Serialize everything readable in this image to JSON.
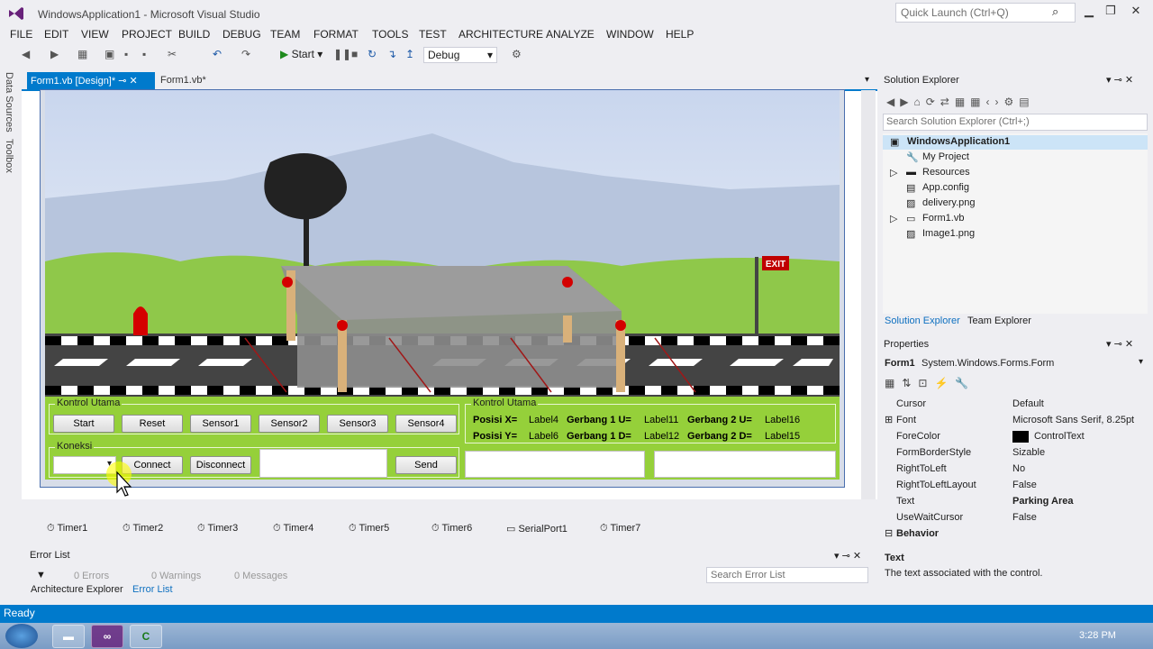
{
  "window": {
    "title": "WindowsApplication1 - Microsoft Visual Studio",
    "quick_launch_placeholder": "Quick Launch (Ctrl+Q)"
  },
  "menu": [
    "FILE",
    "EDIT",
    "VIEW",
    "PROJECT",
    "BUILD",
    "DEBUG",
    "TEAM",
    "FORMAT",
    "TOOLS",
    "TEST",
    "ARCHITECTURE",
    "ANALYZE",
    "WINDOW",
    "HELP"
  ],
  "toolbar": {
    "start_label": "Start",
    "config": "Debug"
  },
  "side_tabs": [
    "Data Sources",
    "Toolbox"
  ],
  "doc_tabs": [
    "Form1.vb [Design]*",
    "Form1.vb*"
  ],
  "form": {
    "group_main": {
      "title": "Kontrol Utama",
      "buttons": [
        "Start",
        "Reset",
        "Sensor1",
        "Sensor2",
        "Sensor3",
        "Sensor4"
      ]
    },
    "group_conn": {
      "title": "Koneksi",
      "connect": "Connect",
      "disconnect": "Disconnect",
      "send": "Send"
    },
    "group_info": {
      "title": "Kontrol Utama",
      "row1": [
        "Posisi X=",
        "Label4",
        "Gerbang 1 U=",
        "Label11",
        "Gerbang 2 U=",
        "Label16"
      ],
      "row2": [
        "Posisi Y=",
        "Label6",
        "Gerbang 1 D=",
        "Label12",
        "Gerbang 2 D=",
        "Label15"
      ]
    },
    "exit_sign": "EXIT"
  },
  "tray": [
    "Timer1",
    "Timer2",
    "Timer3",
    "Timer4",
    "Timer5",
    "Timer6",
    "SerialPort1",
    "Timer7"
  ],
  "error_list": {
    "title": "Error List",
    "errors": "0 Errors",
    "warnings": "0 Warnings",
    "messages": "0 Messages",
    "search_placeholder": "Search Error List",
    "tabs": [
      "Architecture Explorer",
      "Error List"
    ]
  },
  "solution_explorer": {
    "title": "Solution Explorer",
    "search_placeholder": "Search Solution Explorer (Ctrl+;)",
    "root": "WindowsApplication1",
    "items": [
      "My Project",
      "Resources",
      "App.config",
      "delivery.png",
      "Form1.vb",
      "Image1.png"
    ],
    "tabs": [
      "Solution Explorer",
      "Team Explorer"
    ]
  },
  "properties": {
    "title": "Properties",
    "object": "Form1",
    "object_type": "System.Windows.Forms.Form",
    "rows": [
      [
        "Cursor",
        "Default"
      ],
      [
        "Font",
        "Microsoft Sans Serif, 8.25pt"
      ],
      [
        "ForeColor",
        "ControlText"
      ],
      [
        "FormBorderStyle",
        "Sizable"
      ],
      [
        "RightToLeft",
        "No"
      ],
      [
        "RightToLeftLayout",
        "False"
      ],
      [
        "Text",
        "Parking Area"
      ],
      [
        "UseWaitCursor",
        "False"
      ]
    ],
    "category": "Behavior",
    "desc_title": "Text",
    "desc": "The text associated with the control."
  },
  "status": "Ready",
  "clock": "3:28 PM"
}
